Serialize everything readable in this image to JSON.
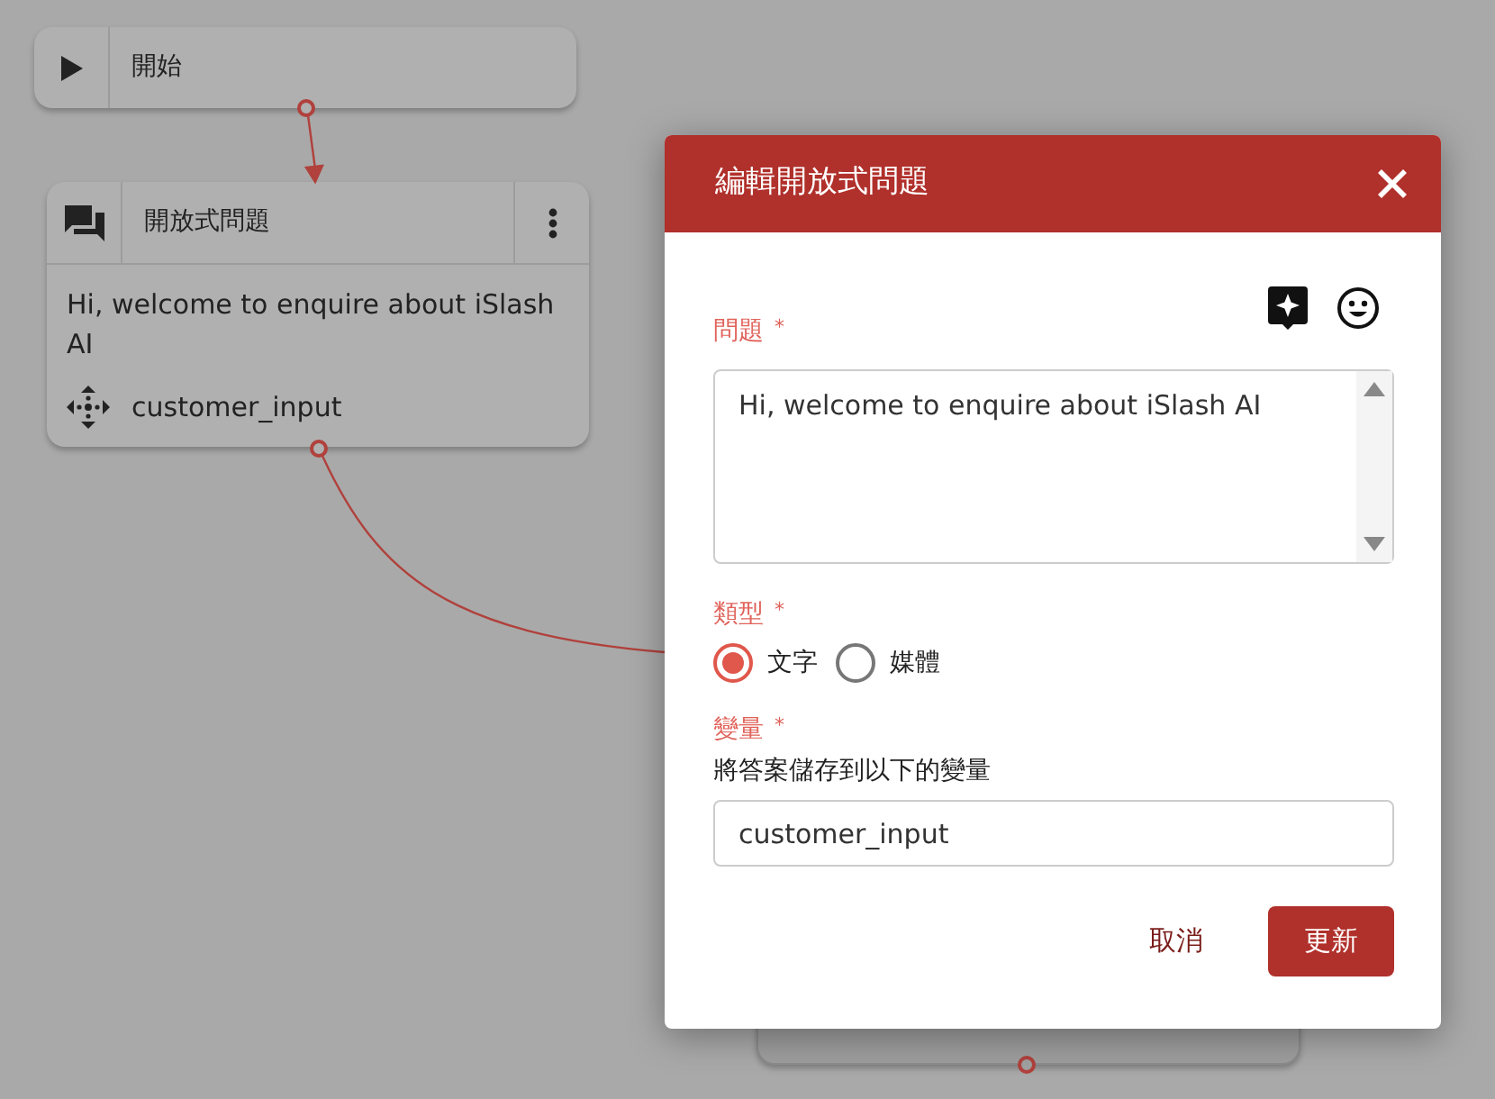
{
  "canvas": {
    "nodes": [
      {
        "kind": "start",
        "title": "開始"
      },
      {
        "kind": "question",
        "title": "開放式問題",
        "message": "Hi, welcome to enquire about iSlash AI",
        "variable": "customer_input"
      },
      {
        "kind": "stub"
      }
    ]
  },
  "dialog": {
    "title": "編輯開放式問題",
    "question": {
      "label": "問題",
      "mark": "*",
      "value": "Hi, welcome to enquire about iSlash AI"
    },
    "type": {
      "label": "類型",
      "mark": "*",
      "options": [
        {
          "label": "文字",
          "selected": true
        },
        {
          "label": "媒體",
          "selected": false
        }
      ]
    },
    "variable": {
      "label": "變量",
      "mark": "*",
      "help": "將答案儲存到以下的變量",
      "value": "customer_input"
    },
    "buttons": [
      {
        "kind": "cancel",
        "label": "取消"
      },
      {
        "kind": "primary",
        "label": "更新"
      }
    ]
  }
}
